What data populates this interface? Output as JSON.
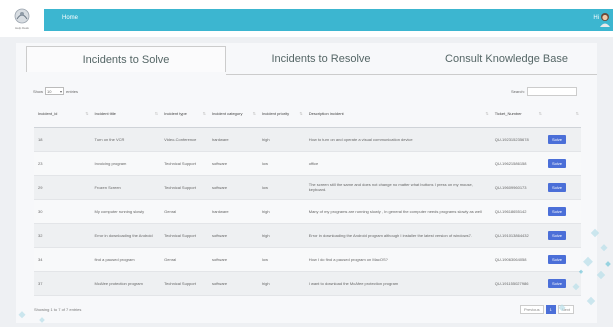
{
  "header": {
    "logo_text": "Help Desk",
    "nav_home": "Home",
    "greeting": "Hi"
  },
  "tabs": [
    {
      "label": "Incidents to Solve",
      "active": true
    },
    {
      "label": "Incidents to Resolve",
      "active": false
    },
    {
      "label": "Consult Knowledge Base",
      "active": false
    }
  ],
  "table_controls": {
    "show_label": "Show",
    "entries_value": "10",
    "entries_label": "entries",
    "search_label": "Search:",
    "search_value": ""
  },
  "table": {
    "columns": [
      "Incident_id",
      "Incident title",
      "Incident type",
      "Incident category",
      "Incident priority",
      "Description incident",
      "Ticket_Number",
      ""
    ],
    "rows": [
      {
        "id": "18",
        "title": "Turn on the VCR",
        "type": "Video-Conference",
        "category": "hardware",
        "priority": "high",
        "description": "How to turn on and operate a visual communication device",
        "ticket": "QU-192315235678",
        "action": "Solve"
      },
      {
        "id": "23",
        "title": "Invoicing program",
        "type": "Technical Support",
        "category": "software",
        "priority": "low",
        "description": "office",
        "ticket": "QU-19621586158",
        "action": "Solve"
      },
      {
        "id": "29",
        "title": "Frozen Screen",
        "type": "Technical Support",
        "category": "software",
        "priority": "low",
        "description": "The screen still the same and does not change no matter what buttons I press on my mouse, keyboard.",
        "ticket": "QU-19609960173",
        "action": "Solve"
      },
      {
        "id": "30",
        "title": "My computer running slowly",
        "type": "Genral",
        "category": "hardware",
        "priority": "high",
        "description": "Many of my programs are running slowly , In general the computer needs programs slowly as well",
        "ticket": "QU-19618655142",
        "action": "Solve"
      },
      {
        "id": "32",
        "title": "Error in downloading the Android",
        "type": "Technical Support",
        "category": "software",
        "priority": "high",
        "description": "Error in downloading the Android program although I installer the latest version of windows7.",
        "ticket": "QU-191013864432",
        "action": "Solve"
      },
      {
        "id": "34",
        "title": "find a paused program",
        "type": "Genral",
        "category": "software",
        "priority": "low",
        "description": "How I do find a paused program on MacOS?",
        "ticket": "QU-19063064058",
        "action": "Solve"
      },
      {
        "id": "37",
        "title": "McAfee protection program",
        "type": "Technical Support",
        "category": "software",
        "priority": "high",
        "description": "I want to download the McAfee protection program",
        "ticket": "QU-191155027986",
        "action": "Solve"
      }
    ]
  },
  "footer": {
    "info": "Showing 1 to 7 of 7 entries",
    "previous": "Previous",
    "current_page": "1",
    "next": "Next"
  },
  "colors": {
    "navbar": "#3cb6d0",
    "solve_button": "#4b6fd8",
    "background": "#eef0f3"
  }
}
